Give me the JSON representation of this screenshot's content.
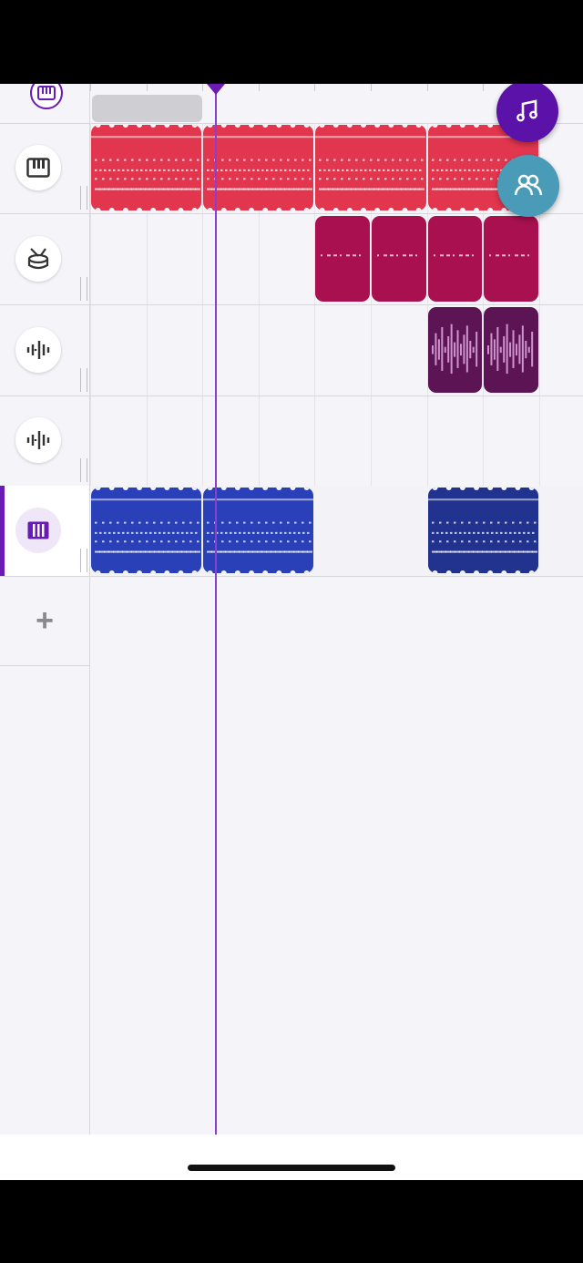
{
  "colors": {
    "accent": "#6a1bb5",
    "keys_track": "#e2364f",
    "drums_track": "#a8104f",
    "audio_track": "#5c1454",
    "synth_track": "#2a40b8",
    "synth_track_dark": "#22338f",
    "collab": "#4a9bb8"
  },
  "sidebar": {
    "top_track": {
      "icon": "piano-icon"
    },
    "tracks": [
      {
        "icon": "keyboard-icon",
        "selected": false
      },
      {
        "icon": "drum-icon",
        "selected": false
      },
      {
        "icon": "waveform-icon",
        "selected": false
      },
      {
        "icon": "waveform-icon",
        "selected": false
      },
      {
        "icon": "piano-icon",
        "selected": true
      }
    ],
    "add_track_label": "+"
  },
  "fabs": {
    "music": {
      "icon": "music-note-icon"
    },
    "collab": {
      "icon": "people-icon"
    }
  },
  "clips": [
    {
      "track": 0,
      "bar_start": 0,
      "bars": 2,
      "type": "midi"
    },
    {
      "track": 0,
      "bar_start": 2,
      "bars": 2,
      "type": "midi"
    },
    {
      "track": 0,
      "bar_start": 4,
      "bars": 2,
      "type": "midi"
    },
    {
      "track": 0,
      "bar_start": 6,
      "bars": 2,
      "type": "midi"
    },
    {
      "track": 1,
      "bar_start": 4,
      "bars": 1,
      "type": "drum"
    },
    {
      "track": 1,
      "bar_start": 5,
      "bars": 1,
      "type": "drum"
    },
    {
      "track": 1,
      "bar_start": 6,
      "bars": 1,
      "type": "drum"
    },
    {
      "track": 1,
      "bar_start": 7,
      "bars": 1,
      "type": "drum"
    },
    {
      "track": 2,
      "bar_start": 6,
      "bars": 1,
      "type": "audio"
    },
    {
      "track": 2,
      "bar_start": 7,
      "bars": 1,
      "type": "audio"
    },
    {
      "track": 4,
      "bar_start": 0,
      "bars": 2,
      "type": "midi"
    },
    {
      "track": 4,
      "bar_start": 2,
      "bars": 2,
      "type": "midi"
    },
    {
      "track": 4,
      "bar_start": 6,
      "bars": 2,
      "type": "midi"
    }
  ]
}
